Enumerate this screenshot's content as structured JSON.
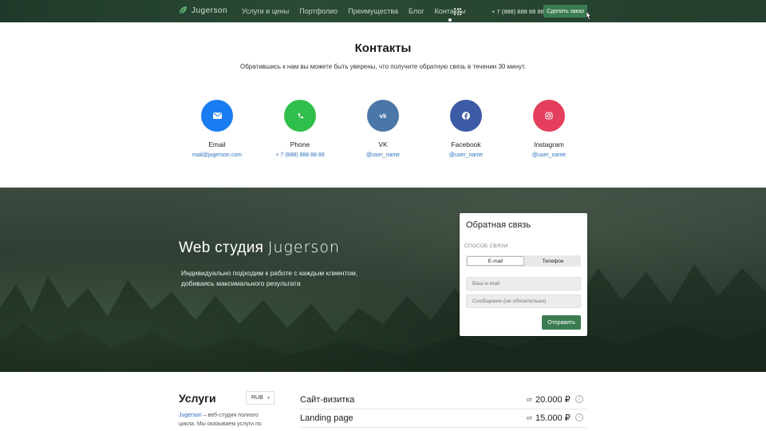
{
  "nav": {
    "brand": "Jugerson",
    "items": [
      {
        "label": "Услуги и цены",
        "active": false
      },
      {
        "label": "Портфолио",
        "active": false
      },
      {
        "label": "Преимущества",
        "active": false
      },
      {
        "label": "Блог",
        "active": false
      },
      {
        "label": "Контакты",
        "active": true
      }
    ],
    "phone": "+ 7 (888) 888 88 88",
    "order_label": "Сделать заказ",
    "grid_icon": "apps-grid-icon",
    "accent": "#3c7c52"
  },
  "contacts": {
    "title": "Контакты",
    "subtitle": "Обратившись к нам вы можете быть уверены, что получите обратную связь в течении 30 минут.",
    "items": [
      {
        "label": "Email",
        "value": "mail@jugerson.com",
        "icon": "email-icon",
        "color": "#1a7cf2"
      },
      {
        "label": "Phone",
        "value": "+ 7 (888) 888 88 88",
        "icon": "phone-icon",
        "color": "#2fbf4a"
      },
      {
        "label": "VK",
        "value": "@user_name",
        "icon": "vk-icon",
        "color": "#4a76a8"
      },
      {
        "label": "Facebook",
        "value": "@user_name",
        "icon": "facebook-icon",
        "color": "#3b5ba6"
      },
      {
        "label": "Instagram",
        "value": "@user_name",
        "icon": "instagram-icon",
        "color": "#e33e5c"
      }
    ]
  },
  "hero": {
    "title_prefix": "Web студия",
    "title_brand": "Jugerson",
    "text": "Индивидуально подходим к работе с каждым клиентом, добиваясь максимального результата"
  },
  "feedback": {
    "title": "Обратная связь",
    "method_label": "СПОСОБ СВЯЗИ",
    "tabs": [
      "E-mail",
      "Телефон"
    ],
    "selected_tab": "E-mail",
    "email_placeholder": "Ваш e-mail",
    "message_placeholder": "Сообщение (не обязательно)",
    "submit_label": "Отправить"
  },
  "services": {
    "title": "Услуги",
    "currency": "RUB",
    "desc_link": "Jugerson",
    "desc_text": " – веб-студия полного цикла. Мы оказываем услуги по",
    "rows": [
      {
        "name": "Сайт-визитка",
        "from": "от",
        "price": "20.000 ₽"
      },
      {
        "name": "Landing page",
        "from": "от",
        "price": "15.000 ₽"
      }
    ]
  }
}
